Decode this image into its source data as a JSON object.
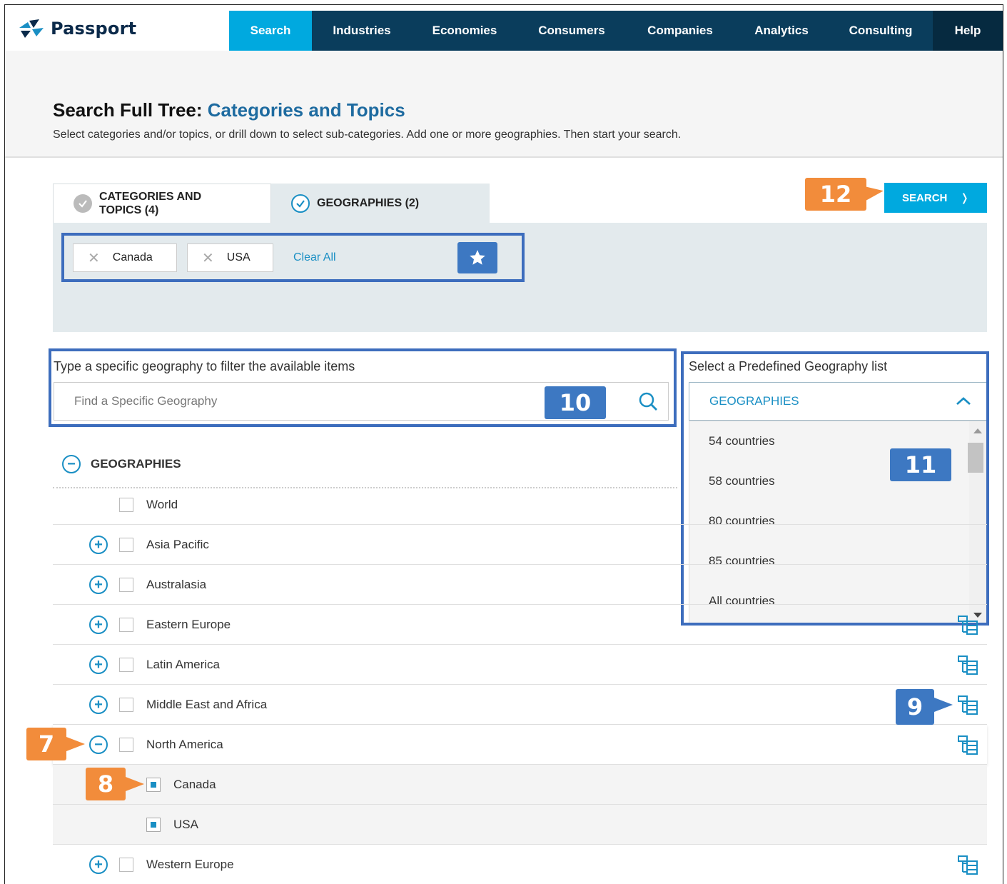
{
  "nav": {
    "logo": "Passport",
    "items": [
      "Search",
      "Industries",
      "Economies",
      "Consumers",
      "Companies",
      "Analytics",
      "Consulting",
      "Help"
    ],
    "active": "Search"
  },
  "header": {
    "title_prefix": "Search Full Tree:",
    "title_accent": "Categories and Topics",
    "subtitle": "Select categories and/or topics, or drill down to select sub-categories. Add one or more geographies. Then start your search."
  },
  "tabs": [
    {
      "label_line1": "CATEGORIES AND",
      "label_line2": "TOPICS (4)"
    },
    {
      "label": "GEOGRAPHIES (2)"
    }
  ],
  "search_button": {
    "label": "SEARCH",
    "arrow": "❭"
  },
  "selected": {
    "chips": [
      "Canada",
      "USA"
    ],
    "clear_all": "Clear All"
  },
  "filter": {
    "label": "Type a specific geography to filter the available items",
    "placeholder": "Find a Specific Geography"
  },
  "predefined": {
    "label": "Select a Predefined Geography list",
    "selected": "GEOGRAPHIES",
    "options": [
      "54 countries",
      "58 countries",
      "80 countries",
      "85 countries",
      "All countries"
    ]
  },
  "tree": {
    "root": "GEOGRAPHIES",
    "rows": [
      {
        "label": "World"
      },
      {
        "label": "Asia Pacific"
      },
      {
        "label": "Australasia"
      },
      {
        "label": "Eastern Europe"
      },
      {
        "label": "Latin America"
      },
      {
        "label": "Middle East and Africa"
      },
      {
        "label": "North America"
      },
      {
        "label": "Canada"
      },
      {
        "label": "USA"
      },
      {
        "label": "Western Europe"
      }
    ]
  },
  "callouts": {
    "c7": "7",
    "c8": "8",
    "c9": "9",
    "c10": "10",
    "c11": "11",
    "c12": "12"
  },
  "colors": {
    "nav_dark": "#0a3d5c",
    "accent": "#00a9df",
    "callout_orange": "#f28c3b",
    "callout_blue": "#3d78c2"
  }
}
